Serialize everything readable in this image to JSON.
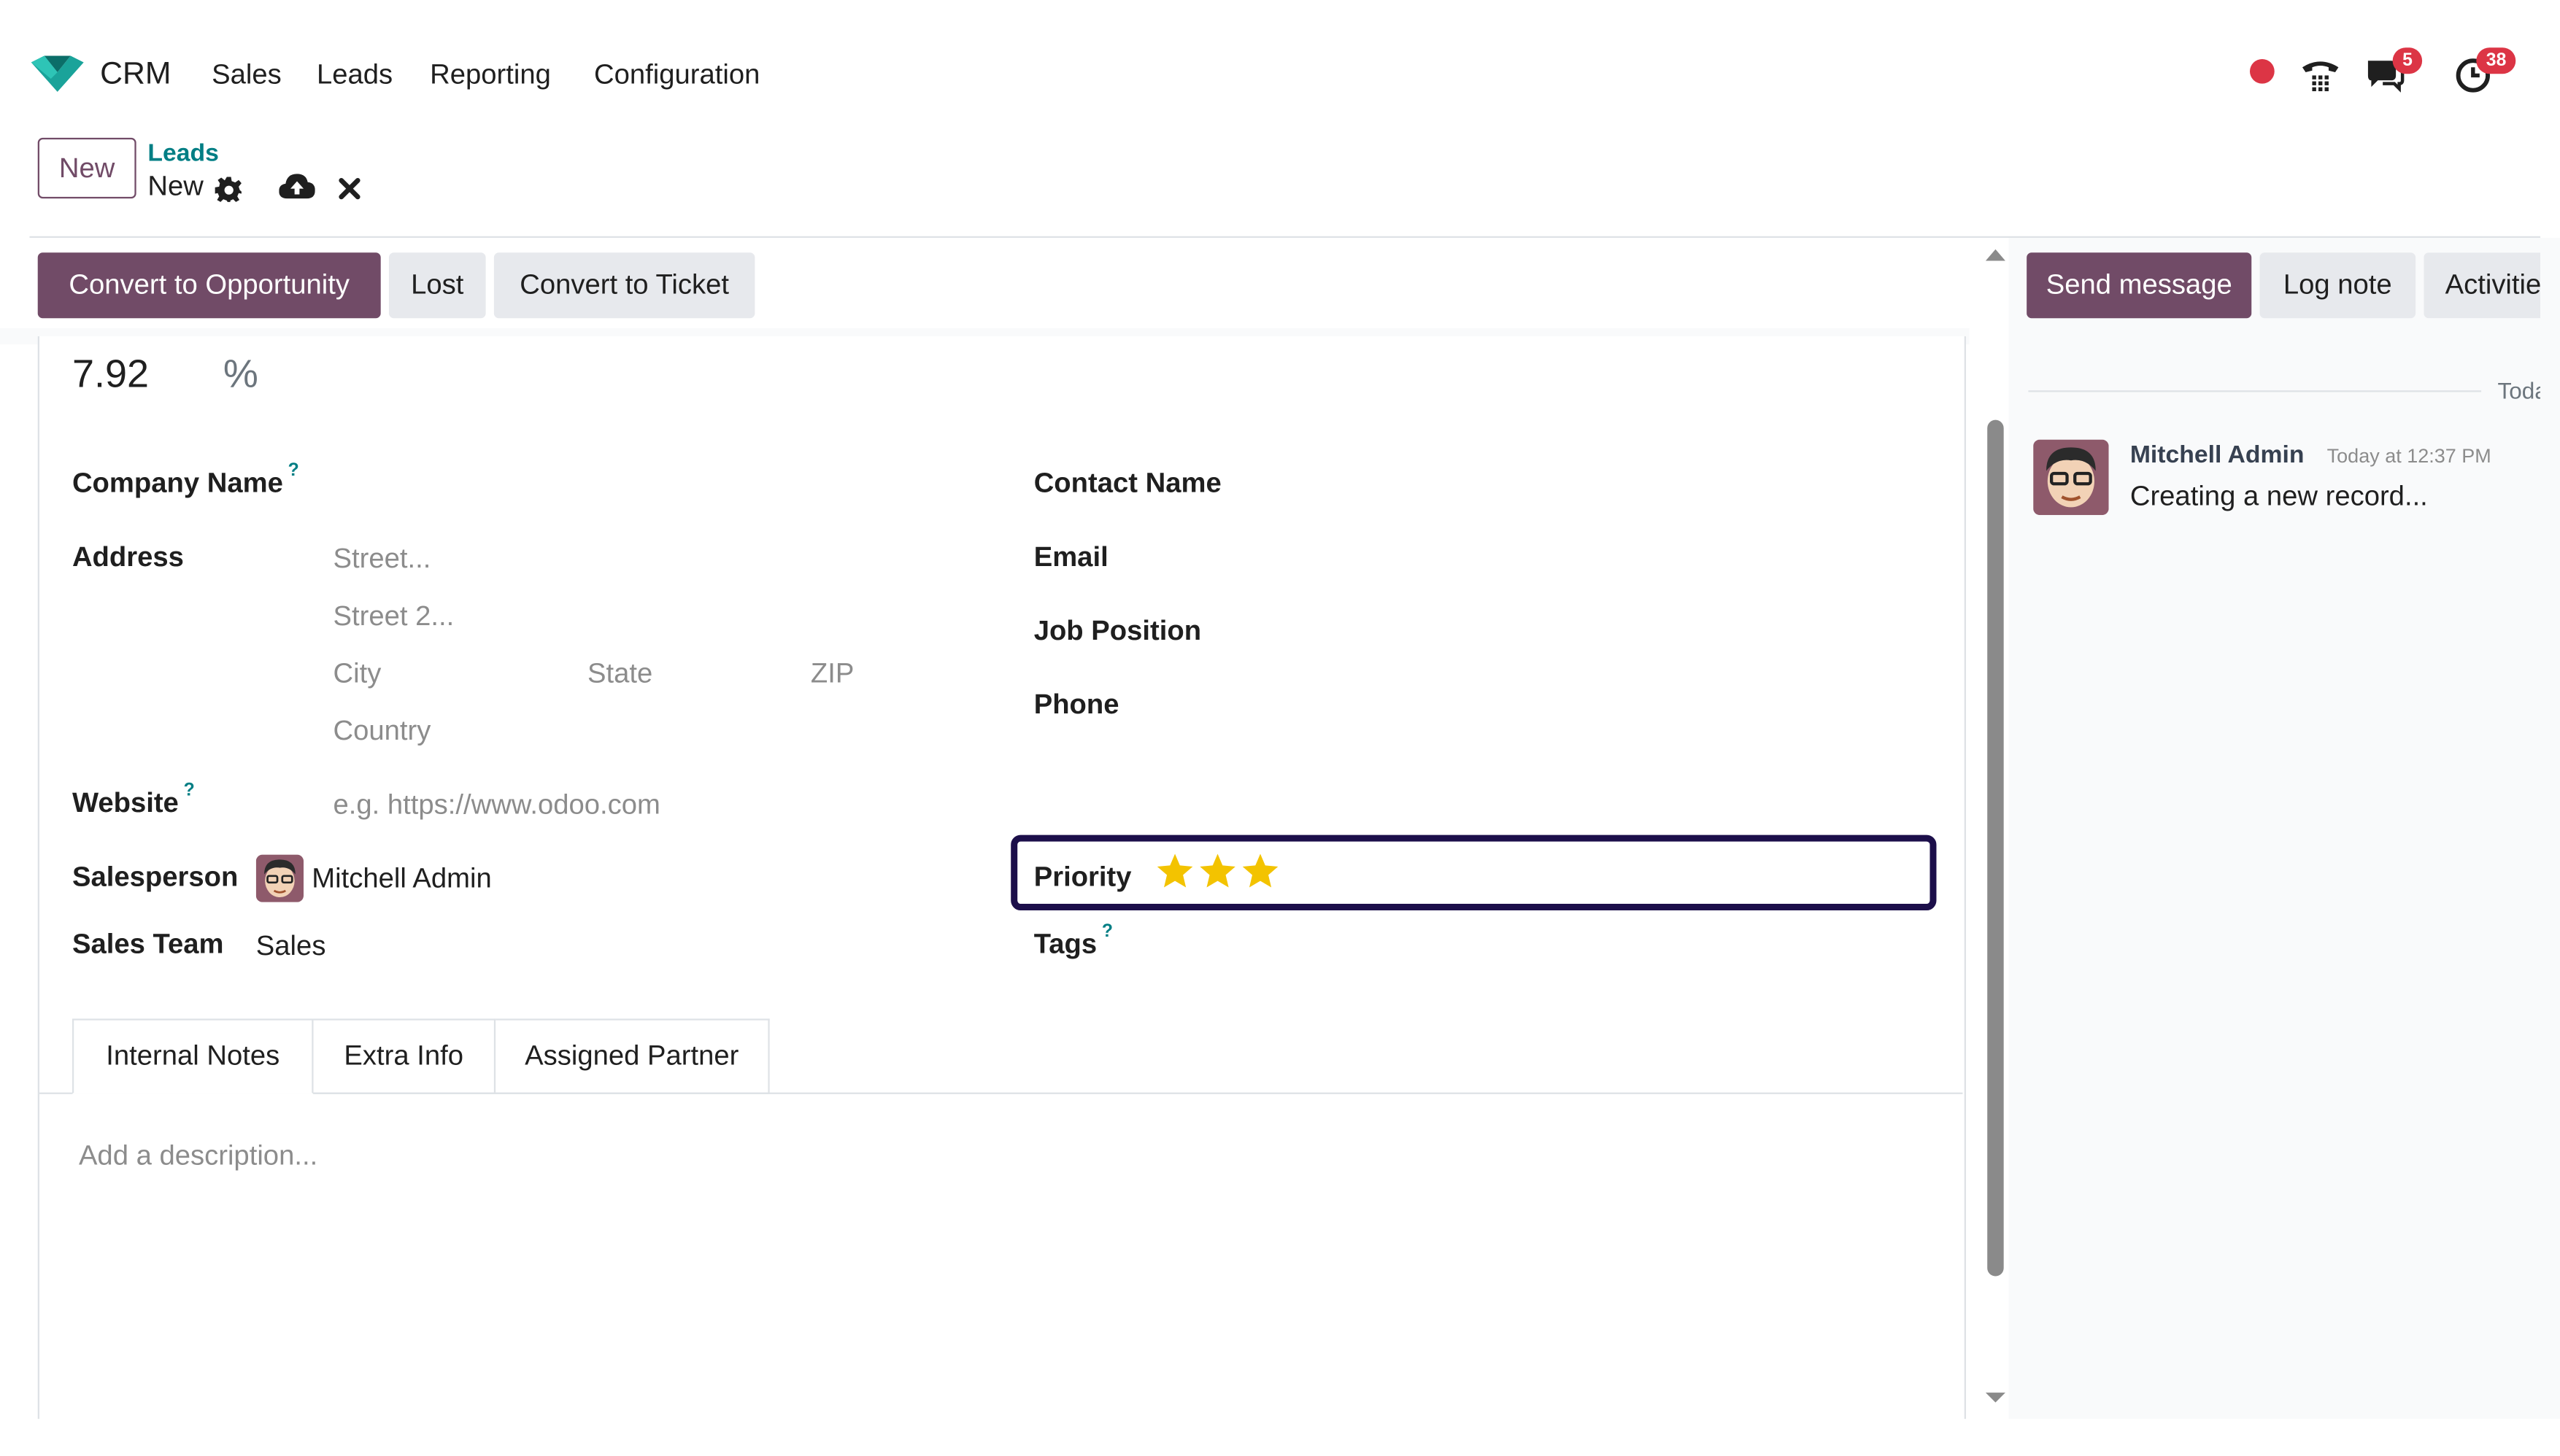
{
  "app": {
    "name": "CRM",
    "menu": [
      "Sales",
      "Leads",
      "Reporting",
      "Configuration"
    ],
    "messages_badge": "5",
    "activities_badge": "38",
    "brand_color": "#714b67",
    "accent_color": "#017e84"
  },
  "control_panel": {
    "new_label": "New",
    "breadcrumb_parent": "Leads",
    "breadcrumb_current": "New"
  },
  "status_bar": {
    "convert_opportunity": "Convert to Opportunity",
    "lost": "Lost",
    "convert_ticket": "Convert to Ticket"
  },
  "form": {
    "probability": "7.92",
    "percent_sign": "%",
    "company_name_label": "Company Name",
    "address_label": "Address",
    "street_placeholder": "Street...",
    "street2_placeholder": "Street 2...",
    "city_placeholder": "City",
    "state_placeholder": "State",
    "zip_placeholder": "ZIP",
    "country_placeholder": "Country",
    "website_label": "Website",
    "website_placeholder": "e.g. https://www.odoo.com",
    "salesperson_label": "Salesperson",
    "salesperson_value": "Mitchell Admin",
    "sales_team_label": "Sales Team",
    "sales_team_value": "Sales",
    "contact_name_label": "Contact Name",
    "email_label": "Email",
    "job_position_label": "Job Position",
    "phone_label": "Phone",
    "priority_label": "Priority",
    "priority_stars": 3,
    "tags_label": "Tags",
    "help_mark": "?"
  },
  "tabs": [
    "Internal Notes",
    "Extra Info",
    "Assigned Partner"
  ],
  "notes_placeholder": "Add a description...",
  "chatter": {
    "send_message": "Send message",
    "log_note": "Log note",
    "activities": "Activities",
    "date_separator": "Today",
    "message": {
      "author": "Mitchell Admin",
      "time": "Today at 12:37 PM",
      "body": "Creating a new record..."
    }
  }
}
